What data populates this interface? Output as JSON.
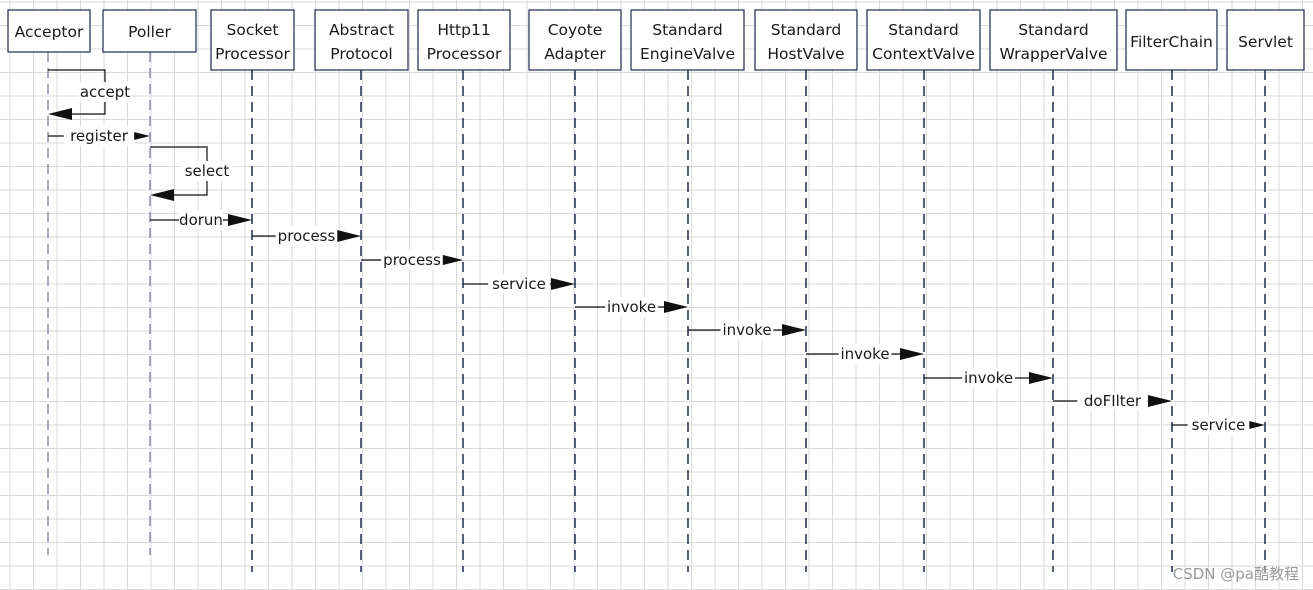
{
  "participants": [
    {
      "lines": [
        "Acceptor"
      ]
    },
    {
      "lines": [
        "Poller"
      ]
    },
    {
      "lines": [
        "Socket",
        "Processor"
      ]
    },
    {
      "lines": [
        "Abstract",
        "Protocol"
      ]
    },
    {
      "lines": [
        "Http11",
        "Processor"
      ]
    },
    {
      "lines": [
        "Coyote",
        "Adapter"
      ]
    },
    {
      "lines": [
        "Standard",
        "EngineValve"
      ]
    },
    {
      "lines": [
        "Standard",
        "HostValve"
      ]
    },
    {
      "lines": [
        "Standard",
        "ContextValve"
      ]
    },
    {
      "lines": [
        "Standard",
        "WrapperValve"
      ]
    },
    {
      "lines": [
        "FilterChain"
      ]
    },
    {
      "lines": [
        "Servlet"
      ]
    }
  ],
  "messages": [
    {
      "label": "accept",
      "from": 0,
      "to": 0
    },
    {
      "label": "register",
      "from": 0,
      "to": 1
    },
    {
      "label": "select",
      "from": 1,
      "to": 1
    },
    {
      "label": "dorun",
      "from": 1,
      "to": 2
    },
    {
      "label": "process",
      "from": 2,
      "to": 3
    },
    {
      "label": "process",
      "from": 3,
      "to": 4
    },
    {
      "label": "service",
      "from": 4,
      "to": 5
    },
    {
      "label": "invoke",
      "from": 5,
      "to": 6
    },
    {
      "label": "invoke",
      "from": 6,
      "to": 7
    },
    {
      "label": "invoke",
      "from": 7,
      "to": 8
    },
    {
      "label": "invoke",
      "from": 8,
      "to": 9
    },
    {
      "label": "doFIlter",
      "from": 9,
      "to": 10
    },
    {
      "label": "service",
      "from": 10,
      "to": 11
    }
  ],
  "watermark": "CSDN @pa酷教程",
  "colors": {
    "grid": "#d9d9d9",
    "box_border": "#1f2a4d",
    "lifeline": "#6b6f8a",
    "text": "#1a1a1a"
  }
}
